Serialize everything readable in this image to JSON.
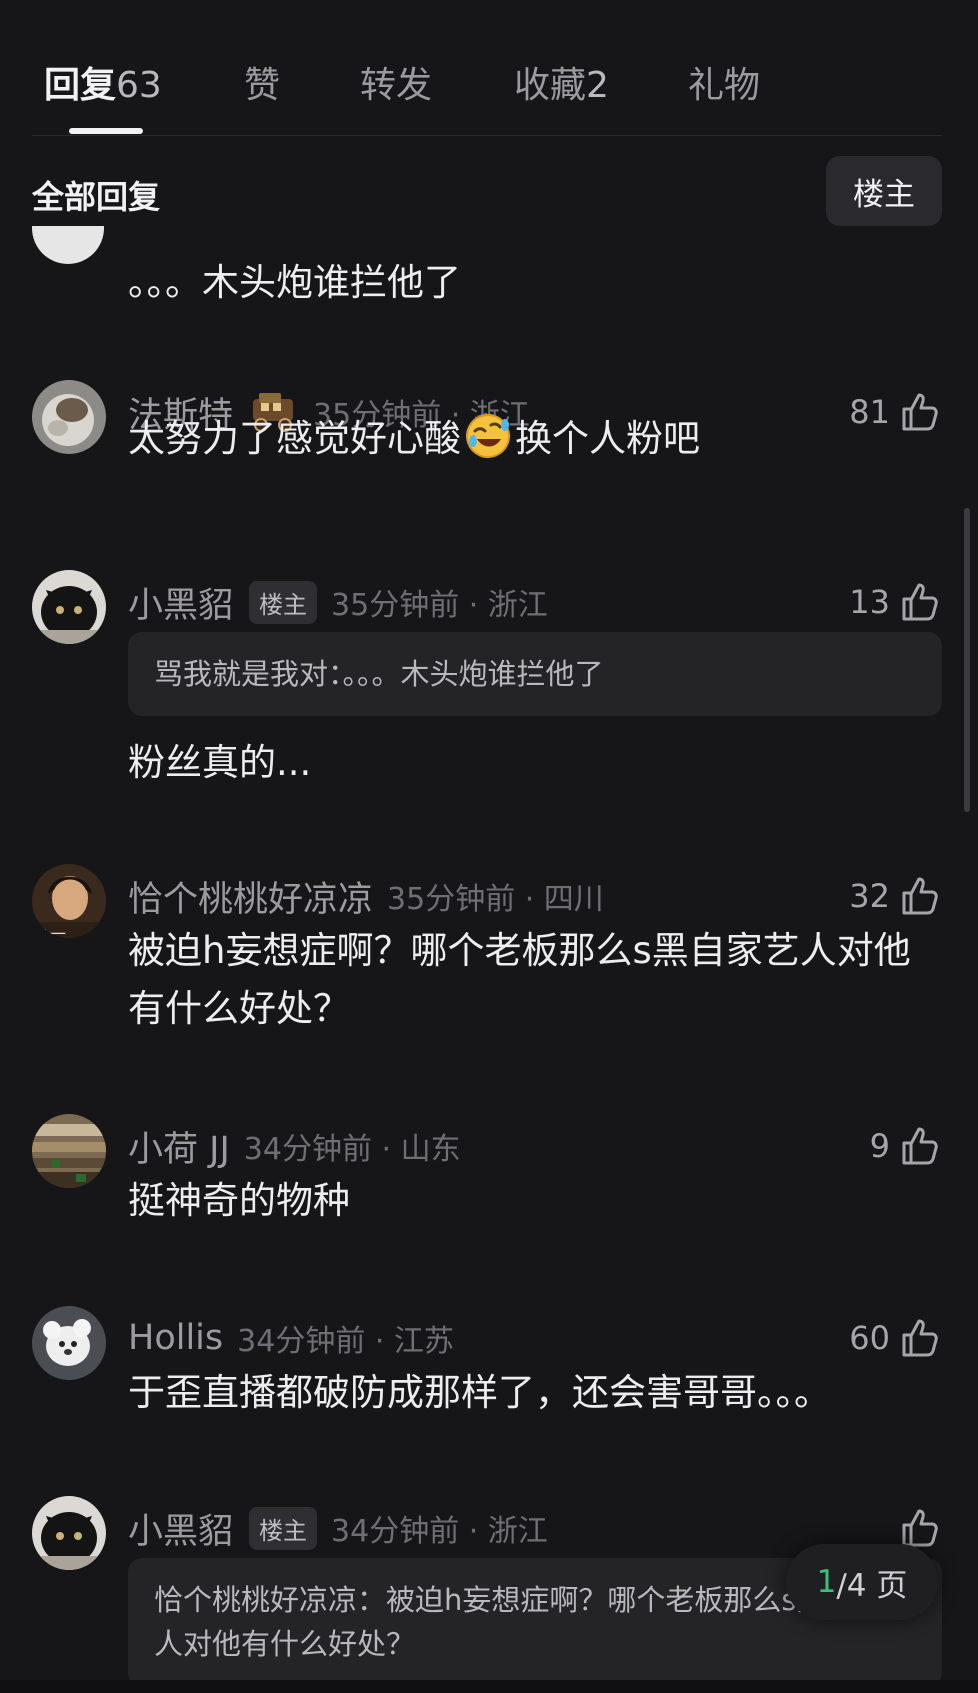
{
  "tabs": [
    {
      "label": "回复",
      "count": "63",
      "active": true
    },
    {
      "label": "赞",
      "count": ""
    },
    {
      "label": "转发",
      "count": ""
    },
    {
      "label": "收藏",
      "count": "2"
    },
    {
      "label": "礼物",
      "count": ""
    }
  ],
  "filter": {
    "title": "全部回复",
    "op_button": "楼主"
  },
  "partial_comment": {
    "text": "。。。木头炮谁拦他了"
  },
  "comments": [
    {
      "user": "法斯特",
      "time": "35分钟前 · 浙江",
      "likes": "81",
      "text_before": "太努力了感觉好心酸",
      "text_after": "换个人粉吧",
      "emoji": "rofl-emoji",
      "medal": "vehicle-badge-icon"
    },
    {
      "user": "小黑貂",
      "op_tag": "楼主",
      "time": "35分钟前 · 浙江",
      "likes": "13",
      "quote": "骂我就是我对：。。。木头炮谁拦他了",
      "text": "粉丝真的..."
    },
    {
      "user": "恰个桃桃好凉凉",
      "time": "35分钟前 · 四川",
      "likes": "32",
      "text": "被迫h妄想症啊？哪个老板那么s黑自家艺人对他有什么好处？"
    },
    {
      "user": "小荷 JJ",
      "time": "34分钟前 · 山东",
      "likes": "9",
      "text": "挺神奇的物种"
    },
    {
      "user": "Hollis",
      "time": "34分钟前 · 江苏",
      "likes": "60",
      "text": "于歪直播都破防成那样了，还会害哥哥。。。"
    },
    {
      "user": "小黑貂",
      "op_tag": "楼主",
      "time": "34分钟前 · 浙江",
      "likes": "",
      "quote": "恰个桃桃好凉凉：被迫h妄想症啊？哪个老板那么s黑自家艺人对他有什么好处？"
    }
  ],
  "pagination": {
    "current": "1",
    "rest": "/4 页"
  },
  "colors": {
    "background": "#161618",
    "accent_green": "#3bc07a"
  }
}
